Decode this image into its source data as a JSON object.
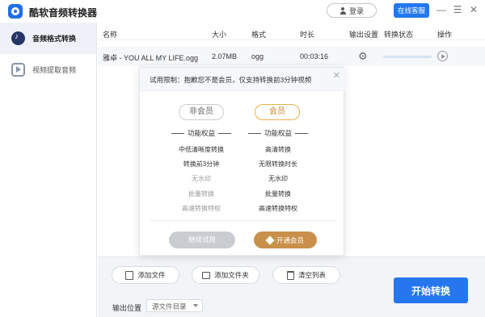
{
  "app": {
    "title": "酷软音频转换器"
  },
  "titlebar": {
    "login_label": "登录",
    "service_label": "在线客服"
  },
  "sidebar": {
    "items": [
      {
        "label": "音频格式转换",
        "icon": "audio-convert-icon",
        "active": true
      },
      {
        "label": "视频提取音频",
        "icon": "video-extract-icon",
        "active": false
      }
    ]
  },
  "table": {
    "headers": {
      "name": "名称",
      "size": "大小",
      "format": "格式",
      "duration": "时长",
      "output": "输出设置",
      "status": "转换状态",
      "action": "操作"
    },
    "rows": [
      {
        "name": "雅卓 - YOU ALL MY LIFE.ogg",
        "size": "2.07MB",
        "format": "ogg",
        "duration": "00:03:16"
      }
    ]
  },
  "modal": {
    "title": "试用限制：抱歉您不是会员，仅支持转换前3分钟视频",
    "nonmember_badge": "非会员",
    "member_badge": "会员",
    "col_head": "功能权益",
    "nonmember_features": [
      "中低清晰度转换",
      "转换前3分钟",
      "无水印",
      "批量转换",
      "高速转换特权"
    ],
    "member_features": [
      "高清转换",
      "无限转换时长",
      "无水印",
      "批量转换",
      "高速转换特权"
    ],
    "trial_button": "继续试用",
    "vip_button": "开通会员",
    "colors": {
      "member_accent": "#c8904a"
    }
  },
  "bottom": {
    "add_file": "添加文件",
    "add_folder": "添加文件夹",
    "clear_list": "清空列表",
    "start_button": "开始转换",
    "output_label": "输出位置",
    "output_value": "源文件目录"
  }
}
